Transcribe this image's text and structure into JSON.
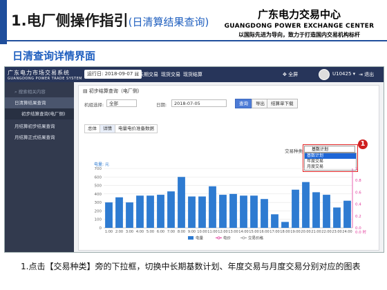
{
  "slide": {
    "title_main": "1.电厂侧操作指引",
    "title_sub": "(日清算结果查询)",
    "org_cn": "广东电力交易中心",
    "org_en": "GUANGDONG POWER EXCHANGE CENTER",
    "slogan": "以国际先进为导向，致力于打造国内交易机构标杆",
    "section_title": "日清查询详情界面",
    "caption": "1.点击【交易种类】旁的下拉框，切换中长期基数计划、年度交易与月度交易分别对应的图表"
  },
  "app": {
    "brand_cn": "广东电力市场交易系统",
    "brand_en": "GUANGDONG POWER TRADE SYSTEM",
    "run_date_label": "运行日:",
    "run_date": "2018-09-07",
    "nav_tabs": [
      "中长期交易",
      "现货交易",
      "现货结算"
    ],
    "fullscreen": "全屏",
    "user": "U10425",
    "logout": "退出"
  },
  "sidebar": {
    "search_placeholder": "搜索相关内容",
    "items": [
      {
        "label": "日清算结果查询"
      },
      {
        "label": "初步结算查询(电厂侧)"
      },
      {
        "label": "月结算初步结果查询"
      },
      {
        "label": "月结算正式结果查询"
      }
    ]
  },
  "panel": {
    "title": "初步结算查询（电厂侧）",
    "unit_label": "机组选择:",
    "unit_value": "全部",
    "date_label": "日期:",
    "date_value": "2018-07-05",
    "btn_query": "查询",
    "btn_export": "导出",
    "btn_download": "结算单下载",
    "tabs": [
      "总体",
      "详情",
      "电量电价准备数据"
    ]
  },
  "dropdown": {
    "label": "交易种类",
    "selected": "基数计划",
    "options": [
      "基数计划",
      "年度交易",
      "月度交易"
    ],
    "badge": "1"
  },
  "chart_data": {
    "type": "bar",
    "ylabel": "电量: 元",
    "categories": [
      "1:00",
      "2:00",
      "3:00",
      "4:00",
      "5:00",
      "6:00",
      "7:00",
      "8:00",
      "9:00",
      "10:00",
      "11:00",
      "12:00",
      "13:00",
      "14:00",
      "15:00",
      "16:00",
      "17:00",
      "18:00",
      "19:00",
      "20:00",
      "21:00",
      "22:00",
      "23:00",
      "24:00"
    ],
    "series": [
      {
        "name": "电量",
        "values": [
          300,
          360,
          300,
          380,
          380,
          390,
          430,
          600,
          370,
          370,
          490,
          390,
          400,
          380,
          380,
          340,
          160,
          70,
          450,
          540,
          420,
          390,
          240,
          320
        ]
      }
    ],
    "ylim": [
      0,
      700
    ],
    "yticks": [
      0,
      100,
      200,
      300,
      400,
      500,
      600,
      700
    ],
    "y2ticks": [
      "0.0",
      "0.2",
      "0.4",
      "0.6",
      "0.8",
      "1"
    ],
    "right_axis_label": "0.0 时",
    "legend": [
      "电量",
      "电价",
      "交易价格"
    ],
    "colors": {
      "bar": "#2e7bd1",
      "axis": "#e23a9b"
    }
  }
}
